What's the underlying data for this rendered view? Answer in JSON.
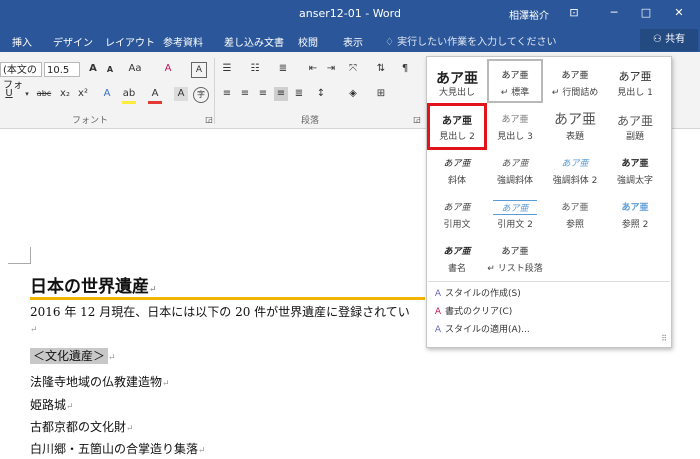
{
  "titlebar": {
    "title": "anser12-01  -  Word",
    "user": "相澤裕介",
    "btn_ribbon": "⊡",
    "btn_min": "─",
    "btn_max": "□",
    "btn_close": "✕"
  },
  "tabs": [
    "挿入",
    "デザイン",
    "レイアウト",
    "参考資料",
    "差し込み文書",
    "校閲",
    "表示"
  ],
  "search_hint": "実行したい作業を入力してください",
  "share": "共有",
  "ribbon": {
    "font_name": "(本文のフォ",
    "font_size": "10.5",
    "grow_font": "A",
    "shrink_font": "A",
    "change_case": "Aa",
    "clear_format": "A",
    "bold": "B",
    "italic": "I",
    "underline": "U",
    "strike": "abc",
    "subscript": "x₂",
    "superscript": "x²",
    "highlight": "ab",
    "font_color": "A",
    "group_font": "フォント",
    "group_paragraph": "段落"
  },
  "document": {
    "heading": "日本の世界遺産",
    "line1": "2016 年 12 月現在、日本には以下の 20 件が世界遺産に登録されてい",
    "section": "＜文化遺産＞",
    "items": [
      "法隆寺地域の仏教建造物",
      "姫路城",
      "古都京都の文化財",
      "白川郷・五箇山の合掌造り集落"
    ],
    "para_mark": "↵"
  },
  "styles": {
    "preview_text": "あア亜",
    "items": [
      {
        "name": "大見出し"
      },
      {
        "name": "↵ 標準"
      },
      {
        "name": "↵ 行間詰め"
      },
      {
        "name": "見出し 1"
      },
      {
        "name": "見出し 2"
      },
      {
        "name": "見出し 3"
      },
      {
        "name": "表題"
      },
      {
        "name": "副題"
      },
      {
        "name": "斜体"
      },
      {
        "name": "強調斜体"
      },
      {
        "name": "強調斜体 2"
      },
      {
        "name": "強調太字"
      },
      {
        "name": "引用文"
      },
      {
        "name": "引用文 2"
      },
      {
        "name": "参照"
      },
      {
        "name": "参照 2"
      },
      {
        "name": "書名"
      },
      {
        "name": "↵ リスト段落"
      }
    ],
    "commands": [
      "スタイルの作成(S)",
      "書式のクリア(C)",
      "スタイルの適用(A)..."
    ]
  }
}
